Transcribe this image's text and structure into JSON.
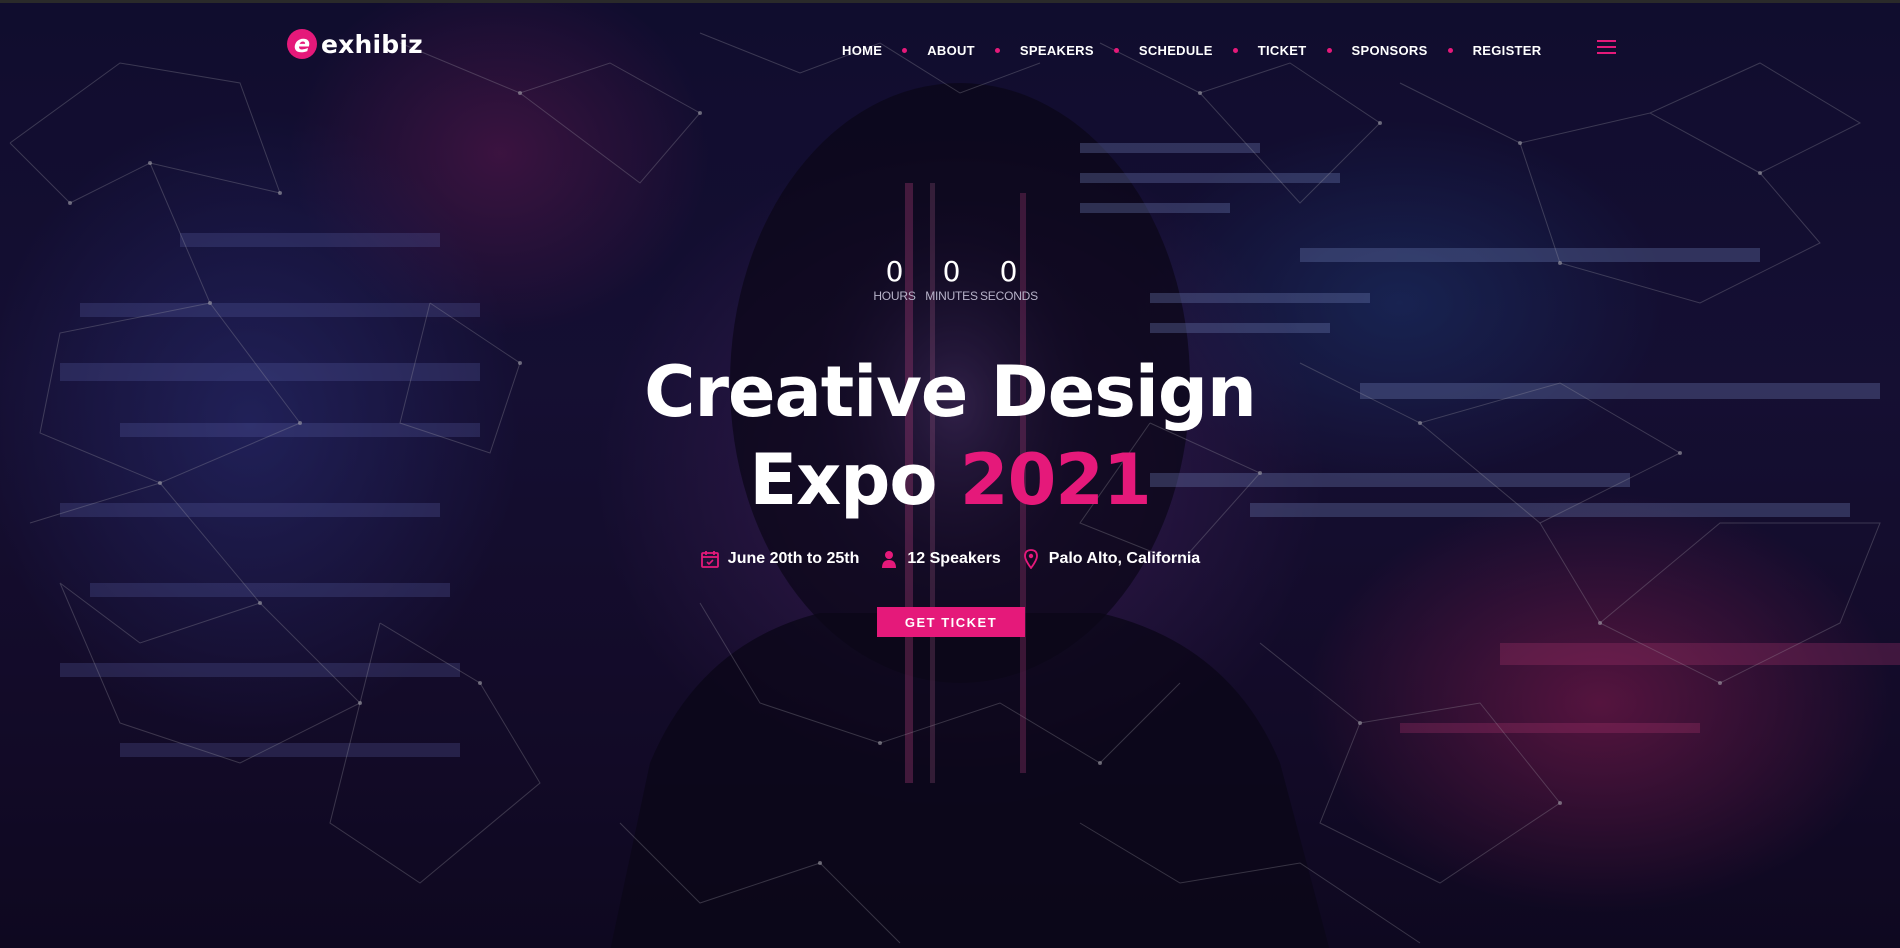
{
  "brand": {
    "logo_letter": "e",
    "name": "exhibiz",
    "accent_color": "#e5197a"
  },
  "nav": {
    "items": [
      {
        "label": "HOME"
      },
      {
        "label": "ABOUT"
      },
      {
        "label": "SPEAKERS"
      },
      {
        "label": "SCHEDULE"
      },
      {
        "label": "TICKET"
      },
      {
        "label": "SPONSORS"
      },
      {
        "label": "REGISTER"
      }
    ],
    "menu_icon": "hamburger-icon"
  },
  "countdown": {
    "hours": "0",
    "minutes": "0",
    "seconds": "0",
    "hours_label": "HOURS",
    "minutes_label": "MINUTES",
    "seconds_label": "SECONDS"
  },
  "hero": {
    "title_line1": "Creative Design",
    "title_line2": "Expo",
    "title_year": "2021",
    "date": "June 20th to 25th",
    "speakers": "12 Speakers",
    "location": "Palo Alto, California",
    "date_icon": "calendar-icon",
    "speakers_icon": "user-icon",
    "location_icon": "map-pin-icon",
    "cta_label": "GET TICKET"
  }
}
